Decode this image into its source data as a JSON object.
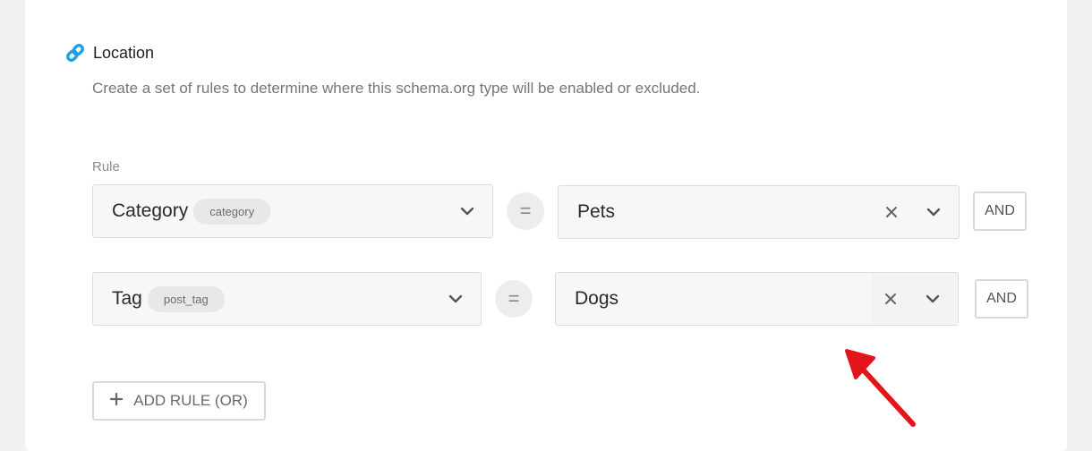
{
  "section": {
    "title": "Location",
    "description": "Create a set of rules to determine where this schema.org type will be enabled or excluded.",
    "icon": "link-icon",
    "icon_color": "#1ea2e3"
  },
  "rules": {
    "label": "Rule",
    "operator_symbol": "=",
    "and_label": "AND",
    "items": [
      {
        "field": "Category",
        "field_slug": "category",
        "value": "Pets"
      },
      {
        "field": "Tag",
        "field_slug": "post_tag",
        "value": "Dogs"
      }
    ]
  },
  "add_rule_label": "ADD RULE (OR)",
  "annotation": {
    "type": "arrow",
    "color": "#e3151b"
  }
}
